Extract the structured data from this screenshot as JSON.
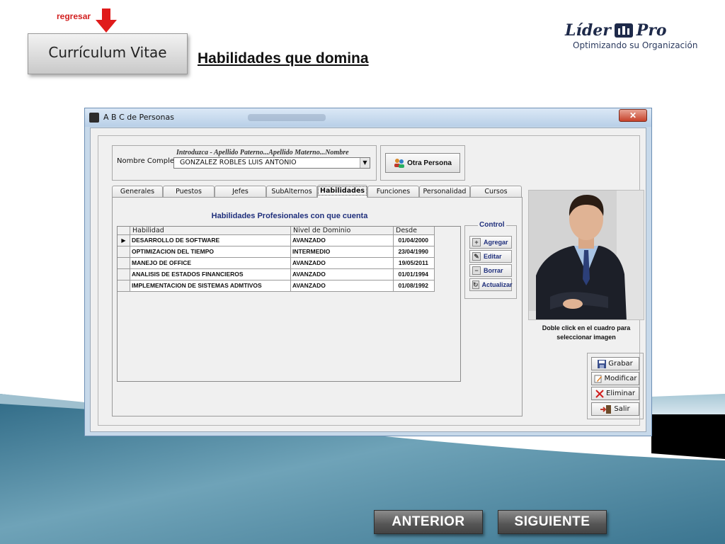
{
  "header": {
    "back_link": "regresar",
    "cv_button": "Currículum Vitae",
    "page_title": "Habilidades que domina"
  },
  "logo": {
    "word1": "Líder",
    "word2": "Pro",
    "tagline": "Optimizando su Organización"
  },
  "window": {
    "title": "A B C de Personas",
    "close_label": "✕",
    "name_hint": "Introduzca - Apellido Paterno...Apellido Materno...Nombre",
    "name_label": "Nombre Completo:",
    "name_value": "GONZALEZ ROBLES LUIS ANTONIO",
    "other_person_label": "Otra Persona",
    "tabs": [
      "Generales",
      "Puestos",
      "Jefes",
      "SubAlternos",
      "Habilidades",
      "Funciones",
      "Personalidad",
      "Cursos"
    ],
    "active_tab": "Habilidades",
    "panel_heading": "Habilidades Profesionales con que cuenta",
    "grid": {
      "columns": [
        "Habilidad",
        "Nivel de Dominio",
        "Desde"
      ],
      "rows": [
        {
          "skill": "DESARROLLO DE SOFTWARE",
          "level": "AVANZADO",
          "since": "01/04/2000"
        },
        {
          "skill": "OPTIMIZACION DEL TIEMPO",
          "level": "INTERMEDIO",
          "since": "23/04/1990"
        },
        {
          "skill": "MANEJO DE OFFICE",
          "level": "AVANZADO",
          "since": "19/05/2011"
        },
        {
          "skill": "ANALISIS DE ESTADOS FINANCIEROS",
          "level": "AVANZADO",
          "since": "01/01/1994"
        },
        {
          "skill": "IMPLEMENTACION DE SISTEMAS ADMTIVOS",
          "level": "AVANZADO",
          "since": "01/08/1992"
        }
      ]
    },
    "control": {
      "legend": "Control",
      "add": "Agregar",
      "edit": "Editar",
      "delete": "Borrar",
      "refresh": "Actualizar"
    },
    "photo_caption": "Doble click en el cuadro para seleccionar imagen",
    "actions": {
      "save": "Grabar",
      "modify": "Modificar",
      "remove": "Eliminar",
      "exit": "Salir"
    }
  },
  "nav": {
    "prev": "ANTERIOR",
    "next": "SIGUIENTE"
  },
  "colors": {
    "accent_red": "#d21f1f",
    "heading_blue": "#1f2f7c",
    "logo_navy": "#1e2a4a",
    "wave_teal": "#3d7a94"
  }
}
